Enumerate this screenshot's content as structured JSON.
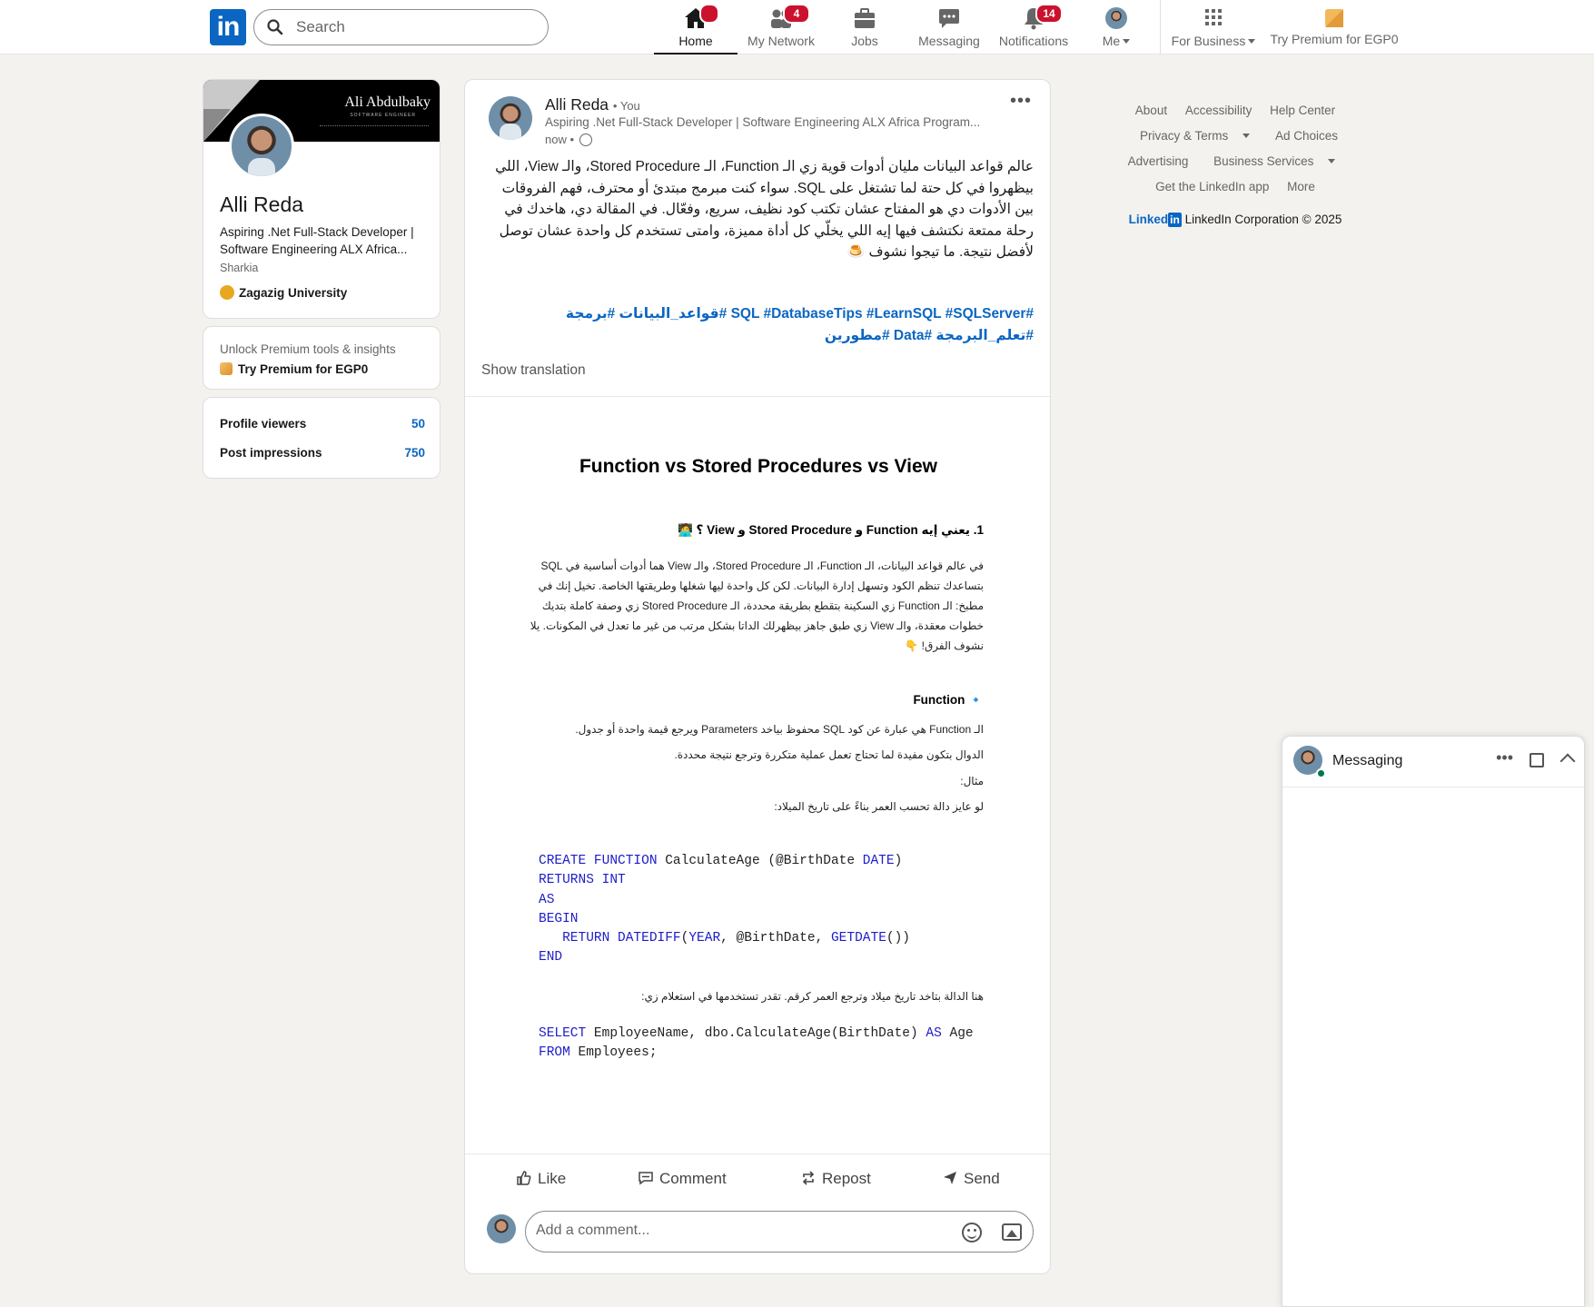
{
  "nav": {
    "search_placeholder": "Search",
    "items": [
      {
        "label": "Home",
        "badge": "",
        "active": true
      },
      {
        "label": "My Network",
        "badge": "4"
      },
      {
        "label": "Jobs",
        "badge": ""
      },
      {
        "label": "Messaging",
        "badge": ""
      },
      {
        "label": "Notifications",
        "badge": "14"
      },
      {
        "label": "Me",
        "badge": ""
      },
      {
        "label": "For Business",
        "badge": ""
      },
      {
        "label": "Try Premium for EGP0",
        "badge": ""
      }
    ]
  },
  "profile": {
    "banner_name": "Ali Abdulbaky",
    "banner_sub": "SOFTWARE ENGINEER",
    "name": "Alli Reda",
    "headline": "Aspiring .Net Full-Stack Developer | Software Engineering ALX Africa...",
    "location": "Sharkia",
    "education": "Zagazig University"
  },
  "premium": {
    "title": "Unlock Premium tools & insights",
    "link": "Try Premium for EGP0"
  },
  "stats": [
    {
      "label": "Profile viewers",
      "value": "50"
    },
    {
      "label": "Post impressions",
      "value": "750"
    }
  ],
  "post": {
    "author": "Alli Reda",
    "you": "• You",
    "subline": "Aspiring .Net Full-Stack Developer | Software Engineering ALX Africa Program...",
    "time": "now •",
    "body": "عالم قواعد البيانات مليان أدوات قوية زي الـ Function، الـ Stored Procedure، والـ View، اللي بيظهروا في كل حتة لما تشتغل على SQL. سواء كنت مبرمج مبتدئ أو محترف، فهم الفروقات بين الأدوات دي هو المفتاح عشان تكتب كود نظيف، سريع، وفعّال. في المقالة دي، هاخدك في رحلة ممتعة نكتشف فيها إيه اللي يخلّي كل أداة مميزة، وامتى تستخدم كل واحدة عشان توصل لأفضل نتيجة. ما تيجوا نشوف 🍮",
    "hashtags": "#SQL #DatabaseTips #LearnSQL #SQLServer #قواعد_البيانات #برمجة #تعلم_البرمجة #Data #مطورين",
    "show_translation": "Show translation",
    "actions": [
      "Like",
      "Comment",
      "Repost",
      "Send"
    ],
    "comment_placeholder": "Add a comment..."
  },
  "doc": {
    "title": "Function vs Stored Procedures vs View",
    "section1": "1.  يعني إيه Function و Stored Procedure و View ؟ 🧑‍💻",
    "para1": "في عالم قواعد البيانات، الـ Function، الـ Stored Procedure، والـ View هما أدوات أساسية في SQL بتساعدك تنظم الكود وتسهل إدارة البيانات. لكن كل واحدة ليها شغلها وطريقتها الخاصة. تخيل إنك في مطبخ: الـ Function زي السكينة بتقطع بطريقة محددة، الـ Stored Procedure زي وصفة كاملة بتديك خطوات معقدة، والـ View زي طبق جاهز بيظهرلك الداتا بشكل مرتب من غير ما تعدل في المكونات. يلا نشوف الفرق! 👇",
    "section2": "🔹 Function",
    "l1": "الـ Function هي عبارة عن كود SQL محفوظ بياخد Parameters ويرجع قيمة واحدة أو جدول.",
    "l2": "الدوال بتكون مفيدة لما تحتاج تعمل عملية متكررة وترجع نتيجة محددة.",
    "l3": "مثال:",
    "l4": "لو عايز دالة تحسب العمر بناءً على تاريخ الميلاد:",
    "l5": "هنا الدالة بتاخد تاريخ ميلاد وترجع العمر كرقم. تقدر تستخدمها في استعلام زي:"
  },
  "footer": {
    "row1": [
      "About",
      "Accessibility",
      "Help Center"
    ],
    "row2": [
      "Privacy & Terms",
      "Ad Choices"
    ],
    "row3": [
      "Advertising",
      "Business Services"
    ],
    "row4": [
      "Get the LinkedIn app",
      "More"
    ],
    "brand_a": "Linked",
    "brand_b": "in",
    "copyright": "LinkedIn Corporation © 2025"
  },
  "messaging": {
    "title": "Messaging"
  }
}
